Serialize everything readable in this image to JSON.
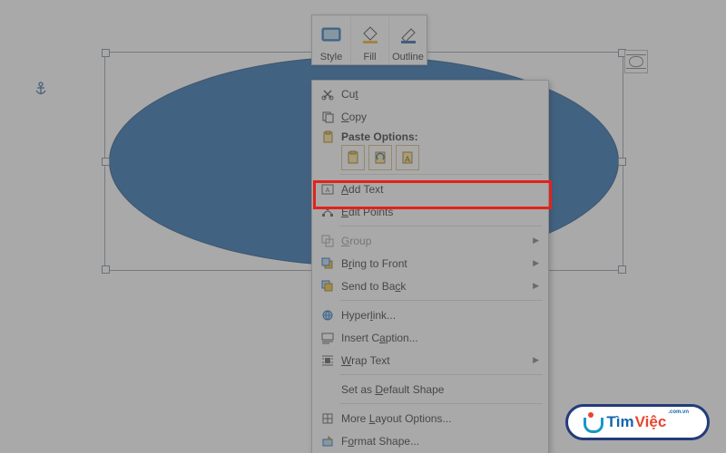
{
  "mini_toolbar": {
    "style_label": "Style",
    "fill_label": "Fill",
    "outline_label": "Outline"
  },
  "context_menu": {
    "cut": "Cut",
    "copy": "Copy",
    "paste_options_title": "Paste Options:",
    "add_text": "Add Text",
    "edit_points": "Edit Points",
    "group": "Group",
    "bring_to_front": "Bring to Front",
    "send_to_back": "Send to Back",
    "hyperlink": "Hyperlink...",
    "insert_caption": "Insert Caption...",
    "wrap_text": "Wrap Text",
    "set_default": "Set as Default Shape",
    "more_layout": "More Layout Options...",
    "format_shape": "Format Shape..."
  },
  "shape": {
    "type": "ellipse",
    "fill_color": "#3b77b3",
    "selected": true
  },
  "highlight": "add_text",
  "watermark": {
    "brand_part1": "Tìm",
    "brand_part2": "Việc",
    "tagline": ".com.vn"
  },
  "icons": {
    "anchor": "anchor-icon",
    "layout_options": "layout-options-icon"
  }
}
